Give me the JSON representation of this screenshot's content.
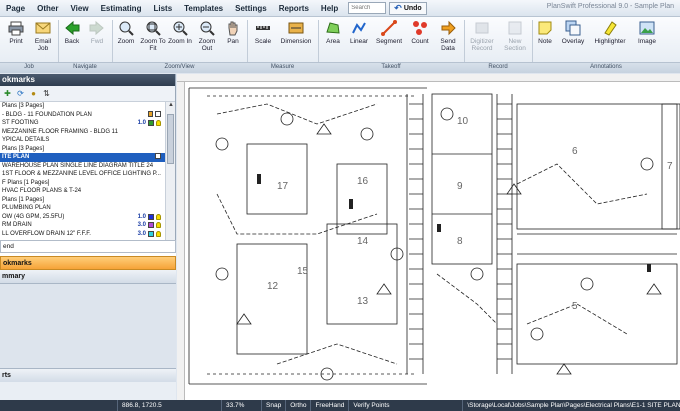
{
  "menubar": {
    "items": [
      "Page",
      "Other",
      "View",
      "Estimating",
      "Lists",
      "Templates",
      "Settings",
      "Reports",
      "Help"
    ],
    "search_placeholder": "Search",
    "undo_label": "Undo",
    "app_title": "PlanSwift Professional 9.0 - Sample Plan"
  },
  "ribbon": {
    "buttons": [
      {
        "label": "Print",
        "icon": "print-icon"
      },
      {
        "label": "Email Job",
        "icon": "email-icon"
      },
      {
        "label": "Back",
        "icon": "back-arrow-icon"
      },
      {
        "label": "Fwd",
        "icon": "forward-arrow-icon",
        "disabled": true
      },
      {
        "label": "Zoom",
        "icon": "zoom-icon"
      },
      {
        "label": "Zoom To Fit",
        "icon": "zoom-fit-icon"
      },
      {
        "label": "Zoom In",
        "icon": "zoom-in-icon"
      },
      {
        "label": "Zoom Out",
        "icon": "zoom-out-icon"
      },
      {
        "label": "Pan",
        "icon": "pan-icon"
      },
      {
        "label": "Scale",
        "icon": "scale-icon"
      },
      {
        "label": "Dimension",
        "icon": "dimension-icon"
      },
      {
        "label": "Area",
        "icon": "area-icon"
      },
      {
        "label": "Linear",
        "icon": "linear-icon"
      },
      {
        "label": "Segment",
        "icon": "segment-icon"
      },
      {
        "label": "Count",
        "icon": "count-icon"
      },
      {
        "label": "Send Data",
        "icon": "send-data-icon"
      },
      {
        "label": "Digitizer Record",
        "icon": "digitizer-icon",
        "disabled": true
      },
      {
        "label": "New Section",
        "icon": "new-section-icon",
        "disabled": true
      },
      {
        "label": "Note",
        "icon": "note-icon"
      },
      {
        "label": "Overlay",
        "icon": "overlay-icon"
      },
      {
        "label": "Highlighter",
        "icon": "highlighter-icon"
      },
      {
        "label": "Image",
        "icon": "image-icon"
      }
    ],
    "groups": [
      "Job",
      "Navigate",
      "Zoom/View",
      "Measure",
      "Takeoff",
      "Record",
      "Annotations"
    ]
  },
  "left_panel": {
    "header": "okmarks",
    "tree": [
      {
        "text": "Plans [3 Pages]"
      },
      {
        "text": "- BLDG - 11 FOUNDATION PLAN"
      },
      {
        "text": "ST FOOTING",
        "value": "1.0",
        "swatch": "#2e9b2e"
      },
      {
        "text": "MEZZANINE FLOOR FRAMING - BLDG 11"
      },
      {
        "text": "YPICAL DETAILS"
      },
      {
        "text": "Plans [3 Pages]"
      },
      {
        "text": "ITE PLAN",
        "selected": true
      },
      {
        "text": "WAREHOUSE PLAN SINGLE LINE DIAGRAM TITLE 24"
      },
      {
        "text": "1ST FLOOR & MEZZANINE LEVEL OFFICE LIGHTING P..."
      },
      {
        "text": "F Plans [1 Pages]"
      },
      {
        "text": "HVAC FLOOR PLANS & T-24"
      },
      {
        "text": "Plans [1 Pages]"
      },
      {
        "text": "PLUMBING PLAN"
      },
      {
        "text": "OW (4G GPM, 25.5FU)",
        "value": "1.0",
        "swatch": "#1e2fd8"
      },
      {
        "text": "RM DRAIN",
        "value": "3.0",
        "swatch": "#b04ad6"
      },
      {
        "text": "LL OVERFLOW DRAIN 12\" F.F.F.",
        "value": "3.0",
        "swatch": "#2fd0e0"
      }
    ],
    "filter_value": "end",
    "nav": {
      "bookmarks": "okmarks",
      "summary": "mmary",
      "reports": "rts"
    }
  },
  "plan": {
    "room_numbers": [
      "10",
      "9",
      "8",
      "6",
      "5",
      "7",
      "12",
      "13",
      "14",
      "15",
      "16",
      "17"
    ]
  },
  "status": {
    "coords": "886.8, 1720.5",
    "zoom": "33.7%",
    "snap": "Snap",
    "ortho": "Ortho",
    "freehand": "FreeHand",
    "verify": "Verify Points",
    "path": "\\Storage\\Local\\Jobs\\Sample Plan\\Pages\\Electrical Plans\\E1-1 SITE PLAN"
  }
}
